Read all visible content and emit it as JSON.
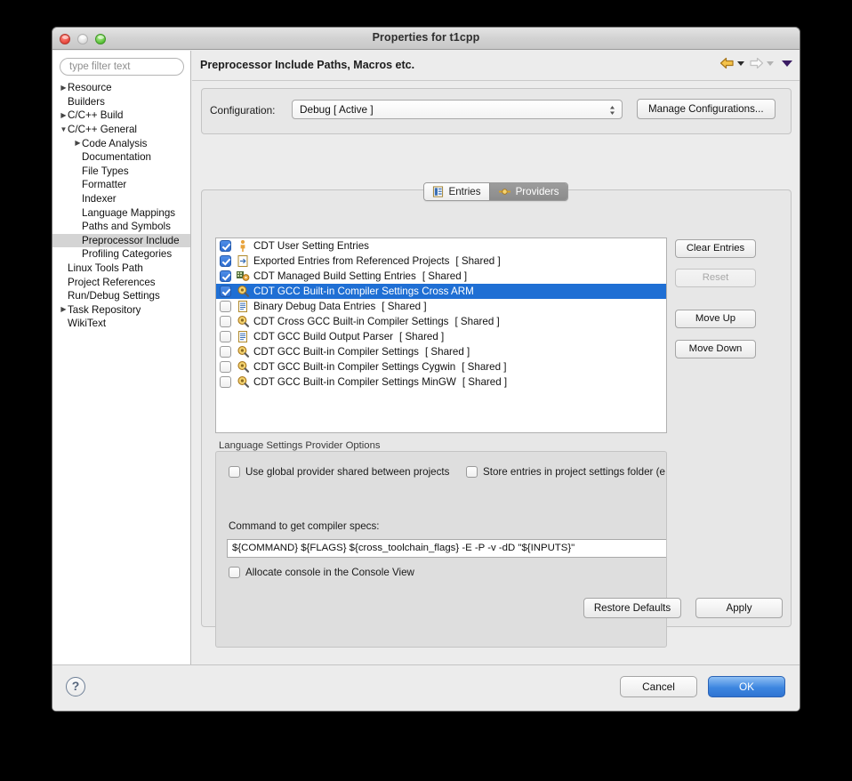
{
  "window": {
    "title": "Properties for t1cpp",
    "traffic": {
      "close": "close-button",
      "minimize": "minimize-button",
      "maximize": "maximize-button"
    }
  },
  "sidebar": {
    "filter_placeholder": "type filter text",
    "items": [
      {
        "label": "Resource",
        "indent": 0,
        "twisty": "▶",
        "selected": false
      },
      {
        "label": "Builders",
        "indent": 0,
        "twisty": "",
        "selected": false
      },
      {
        "label": "C/C++ Build",
        "indent": 0,
        "twisty": "▶",
        "selected": false
      },
      {
        "label": "C/C++ General",
        "indent": 0,
        "twisty": "▼",
        "selected": false
      },
      {
        "label": "Code Analysis",
        "indent": 1,
        "twisty": "▶",
        "selected": false
      },
      {
        "label": "Documentation",
        "indent": 1,
        "twisty": "",
        "selected": false
      },
      {
        "label": "File Types",
        "indent": 1,
        "twisty": "",
        "selected": false
      },
      {
        "label": "Formatter",
        "indent": 1,
        "twisty": "",
        "selected": false
      },
      {
        "label": "Indexer",
        "indent": 1,
        "twisty": "",
        "selected": false
      },
      {
        "label": "Language Mappings",
        "indent": 1,
        "twisty": "",
        "selected": false
      },
      {
        "label": "Paths and Symbols",
        "indent": 1,
        "twisty": "",
        "selected": false
      },
      {
        "label": "Preprocessor Include",
        "indent": 1,
        "twisty": "",
        "selected": true
      },
      {
        "label": "Profiling Categories",
        "indent": 1,
        "twisty": "",
        "selected": false
      },
      {
        "label": "Linux Tools Path",
        "indent": 0,
        "twisty": "",
        "selected": false
      },
      {
        "label": "Project References",
        "indent": 0,
        "twisty": "",
        "selected": false
      },
      {
        "label": "Run/Debug Settings",
        "indent": 0,
        "twisty": "",
        "selected": false
      },
      {
        "label": "Task Repository",
        "indent": 0,
        "twisty": "▶",
        "selected": false
      },
      {
        "label": "WikiText",
        "indent": 0,
        "twisty": "",
        "selected": false
      }
    ]
  },
  "page": {
    "title": "Preprocessor Include Paths, Macros etc.",
    "nav": {
      "back": "back-arrow-icon",
      "forward": "forward-arrow-icon",
      "menu": "view-menu-chevron-icon"
    }
  },
  "configuration": {
    "label": "Configuration:",
    "selected": "Debug  [ Active ]",
    "manage_label": "Manage Configurations..."
  },
  "tabs": [
    {
      "label": "Entries",
      "icon": "entries-icon",
      "active": false
    },
    {
      "label": "Providers",
      "icon": "providers-icon",
      "active": true
    }
  ],
  "providers": [
    {
      "label": "CDT User Setting Entries",
      "shared": "",
      "checked": true,
      "selected": false,
      "icon": "user-person-icon"
    },
    {
      "label": "Exported Entries from Referenced Projects",
      "shared": "[ Shared ]",
      "checked": true,
      "selected": false,
      "icon": "export-document-icon"
    },
    {
      "label": "CDT Managed Build Setting Entries",
      "shared": "[ Shared ]",
      "checked": true,
      "selected": false,
      "icon": "managed-build-icon"
    },
    {
      "label": "CDT GCC Built-in Compiler Settings Cross ARM",
      "shared": "",
      "checked": true,
      "selected": true,
      "icon": "magnifier-gear-icon"
    },
    {
      "label": "Binary Debug Data Entries",
      "shared": "[ Shared ]",
      "checked": false,
      "selected": false,
      "icon": "document-lines-icon"
    },
    {
      "label": "CDT Cross GCC Built-in Compiler Settings",
      "shared": "[ Shared ]",
      "checked": false,
      "selected": false,
      "icon": "magnifier-gear-icon"
    },
    {
      "label": "CDT GCC Build Output Parser",
      "shared": "[ Shared ]",
      "checked": false,
      "selected": false,
      "icon": "document-lines-icon"
    },
    {
      "label": "CDT GCC Built-in Compiler Settings",
      "shared": "[ Shared ]",
      "checked": false,
      "selected": false,
      "icon": "magnifier-gear-icon"
    },
    {
      "label": "CDT GCC Built-in Compiler Settings Cygwin",
      "shared": "[ Shared ]",
      "checked": false,
      "selected": false,
      "icon": "magnifier-gear-icon"
    },
    {
      "label": "CDT GCC Built-in Compiler Settings MinGW",
      "shared": "[ Shared ]",
      "checked": false,
      "selected": false,
      "icon": "magnifier-gear-icon"
    }
  ],
  "side_buttons": {
    "clear_entries": "Clear Entries",
    "reset": "Reset",
    "move_up": "Move Up",
    "move_down": "Move Down"
  },
  "options": {
    "legend": "Language Settings Provider Options",
    "use_global": {
      "label": "Use global provider shared between projects",
      "checked": false
    },
    "store_entries": {
      "label": "Store entries in project settings folder (e",
      "checked": false
    },
    "command_label": "Command to get compiler specs:",
    "command_value": "${COMMAND} ${FLAGS} ${cross_toolchain_flags} -E -P -v -dD \"${INPUTS}\"",
    "allocate_console": {
      "label": "Allocate console in the Console View",
      "checked": false
    }
  },
  "group_buttons": {
    "restore_defaults": "Restore Defaults",
    "apply": "Apply"
  },
  "footer": {
    "help": "?",
    "cancel": "Cancel",
    "ok": "OK"
  },
  "colors": {
    "selection_blue": "#1f6fd4",
    "default_button_blue": "#3d86e0",
    "window_bg": "#ececec",
    "list_bg": "#ffffff"
  }
}
